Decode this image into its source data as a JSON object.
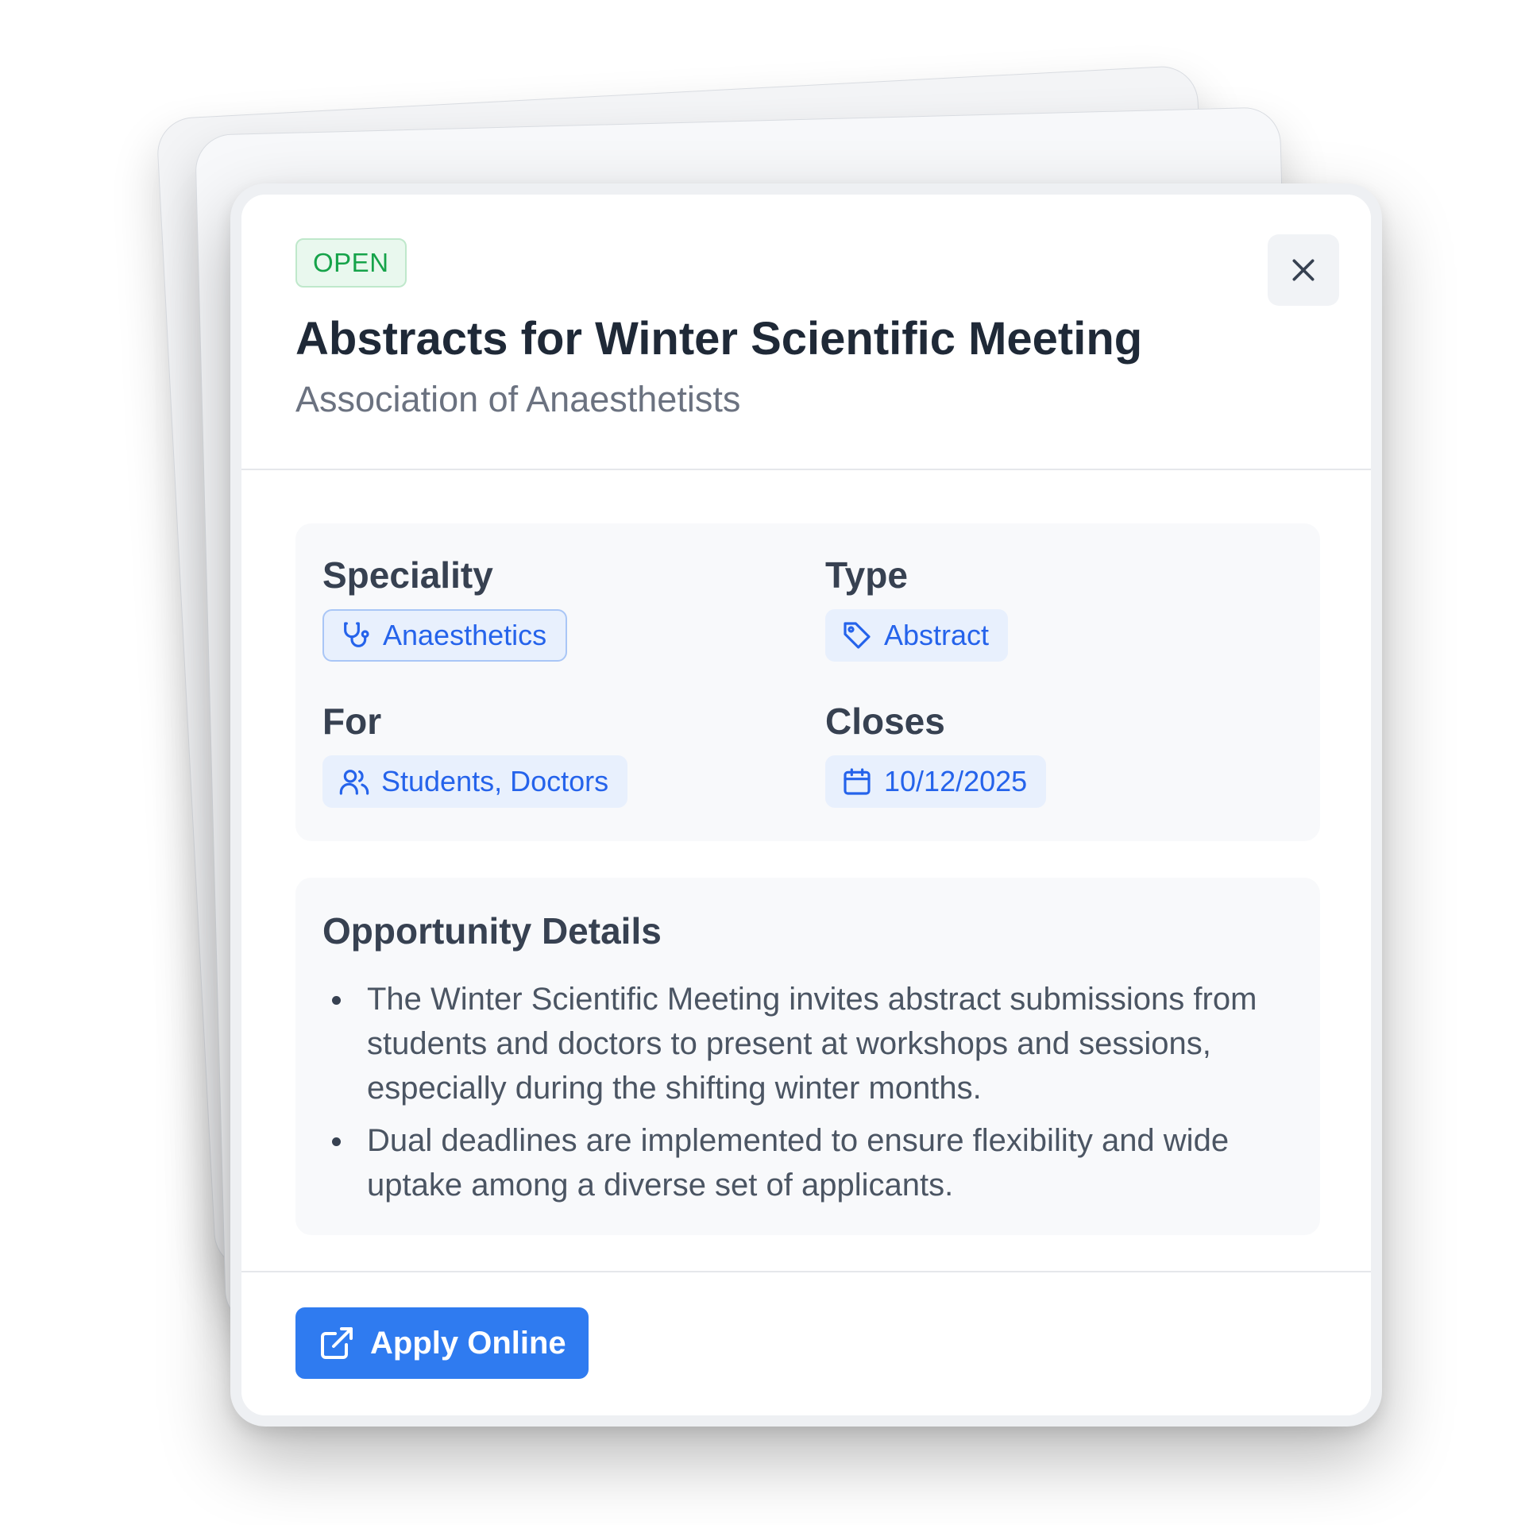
{
  "modal": {
    "status_badge": "OPEN",
    "title": "Abstracts for Winter Scientific Meeting",
    "organization": "Association of Anaesthetists",
    "close_icon": "close-icon"
  },
  "meta": {
    "speciality": {
      "label": "Speciality",
      "value": "Anaesthetics",
      "icon": "stethoscope-icon"
    },
    "type": {
      "label": "Type",
      "value": "Abstract",
      "icon": "tag-icon"
    },
    "for": {
      "label": "For",
      "value": "Students, Doctors",
      "icon": "users-icon"
    },
    "closes": {
      "label": "Closes",
      "value": "10/12/2025",
      "icon": "calendar-icon"
    }
  },
  "details": {
    "title": "Opportunity Details",
    "items": [
      "The Winter Scientific Meeting invites abstract submissions from students and doctors to present at workshops and sessions, especially during the shifting winter months.",
      "Dual deadlines are implemented to ensure flexibility and wide uptake among a diverse set of applicants."
    ]
  },
  "footer": {
    "apply_label": "Apply Online",
    "apply_icon": "external-link-icon"
  },
  "colors": {
    "accent": "#2f7bf0",
    "status_green": "#16a34a",
    "chip_text": "#2563eb"
  }
}
